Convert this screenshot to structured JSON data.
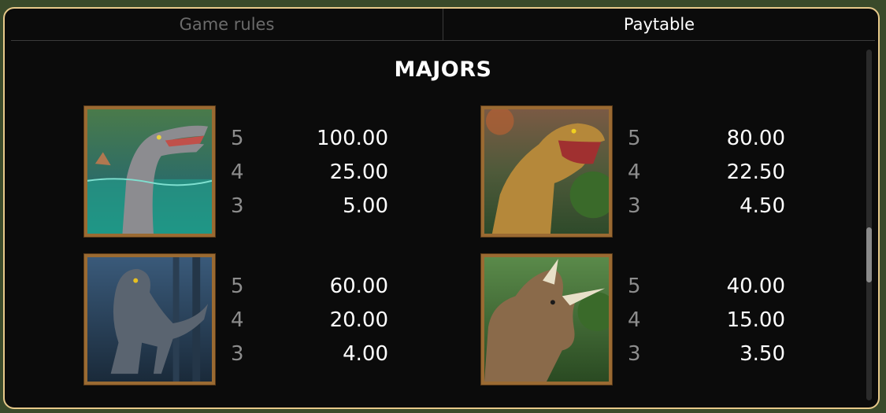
{
  "tabs": [
    {
      "label": "Game rules",
      "active": false
    },
    {
      "label": "Paytable",
      "active": true
    }
  ],
  "section_title": "MAJORS",
  "symbols": [
    {
      "icon": "spinosaurus-symbol-icon",
      "pays": [
        {
          "count": "5",
          "value": "100.00"
        },
        {
          "count": "4",
          "value": "25.00"
        },
        {
          "count": "3",
          "value": "5.00"
        }
      ]
    },
    {
      "icon": "t-rex-symbol-icon",
      "pays": [
        {
          "count": "5",
          "value": "80.00"
        },
        {
          "count": "4",
          "value": "22.50"
        },
        {
          "count": "3",
          "value": "4.50"
        }
      ]
    },
    {
      "icon": "raptor-symbol-icon",
      "pays": [
        {
          "count": "5",
          "value": "60.00"
        },
        {
          "count": "4",
          "value": "20.00"
        },
        {
          "count": "3",
          "value": "4.00"
        }
      ]
    },
    {
      "icon": "triceratops-symbol-icon",
      "pays": [
        {
          "count": "5",
          "value": "40.00"
        },
        {
          "count": "4",
          "value": "15.00"
        },
        {
          "count": "3",
          "value": "3.50"
        }
      ]
    }
  ],
  "colors": {
    "frame_border": "#e7c98a",
    "panel_background": "#0b0b0b",
    "symbol_border": "#9a6a32"
  }
}
